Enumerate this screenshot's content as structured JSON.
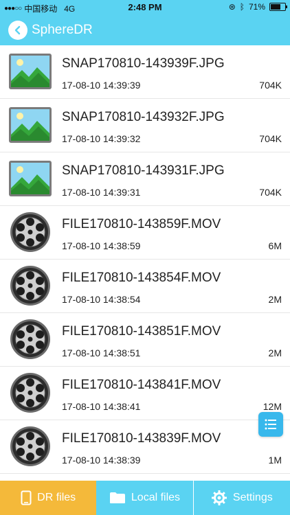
{
  "status": {
    "carrier": "中国移动",
    "network": "4G",
    "time": "2:48 PM",
    "battery": "71%",
    "battery_level": 0.71
  },
  "nav": {
    "title": "SphereDR"
  },
  "files": [
    {
      "name": "SNAP170810-143939F.JPG",
      "date": "17-08-10 14:39:39",
      "size": "704K",
      "type": "image"
    },
    {
      "name": "SNAP170810-143932F.JPG",
      "date": "17-08-10 14:39:32",
      "size": "704K",
      "type": "image"
    },
    {
      "name": "SNAP170810-143931F.JPG",
      "date": "17-08-10 14:39:31",
      "size": "704K",
      "type": "image"
    },
    {
      "name": "FILE170810-143859F.MOV",
      "date": "17-08-10 14:38:59",
      "size": "6M",
      "type": "video"
    },
    {
      "name": "FILE170810-143854F.MOV",
      "date": "17-08-10 14:38:54",
      "size": "2M",
      "type": "video"
    },
    {
      "name": "FILE170810-143851F.MOV",
      "date": "17-08-10 14:38:51",
      "size": "2M",
      "type": "video"
    },
    {
      "name": "FILE170810-143841F.MOV",
      "date": "17-08-10 14:38:41",
      "size": "12M",
      "type": "video"
    },
    {
      "name": "FILE170810-143839F.MOV",
      "date": "17-08-10 14:38:39",
      "size": "1M",
      "type": "video"
    }
  ],
  "tabs": [
    {
      "label": "DR files",
      "icon": "phone-icon",
      "active": true
    },
    {
      "label": "Local files",
      "icon": "folder-icon",
      "active": false
    },
    {
      "label": "Settings",
      "icon": "gear-icon",
      "active": false
    }
  ],
  "colors": {
    "header": "#5ad3f2",
    "active_tab": "#f4b93a",
    "fab": "#38b8ec"
  }
}
